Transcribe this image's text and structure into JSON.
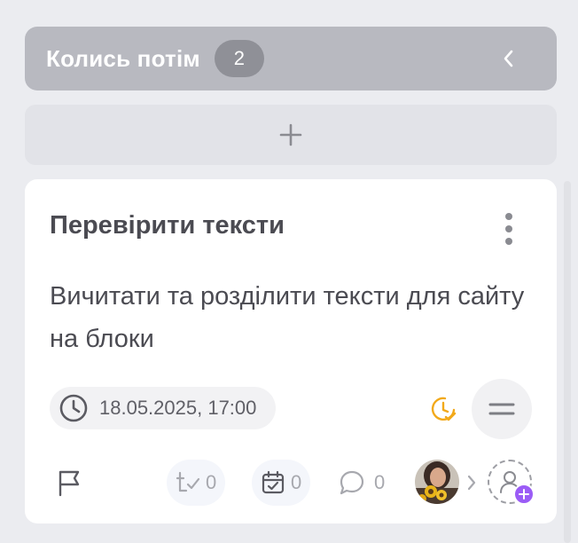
{
  "column": {
    "title": "Колись потім",
    "count": "2"
  },
  "card": {
    "title": "Перевірити тексти",
    "description": "Вичитати та розділити тексти для сайту на блоки",
    "due_date": "18.05.2025, 17:00",
    "checklist_count": "0",
    "subtasks_count": "0",
    "comments_count": "0"
  },
  "colors": {
    "column_header": "#b8b9c0",
    "badge": "#8f9097",
    "deadline_icon": "#f2a91a",
    "add_assignee_accent": "#9b5cf6"
  },
  "icons": {
    "collapse": "chevron-left-icon",
    "add_card": "plus-icon",
    "menu": "more-vertical-icon",
    "due_date": "clock-icon",
    "deadline_status": "clock-check-icon",
    "priority": "priority-medium-icon",
    "flag": "flag-icon",
    "checklist": "checklist-icon",
    "subtasks": "calendar-check-icon",
    "comments": "comment-icon",
    "add_assignee": "user-plus-icon"
  }
}
